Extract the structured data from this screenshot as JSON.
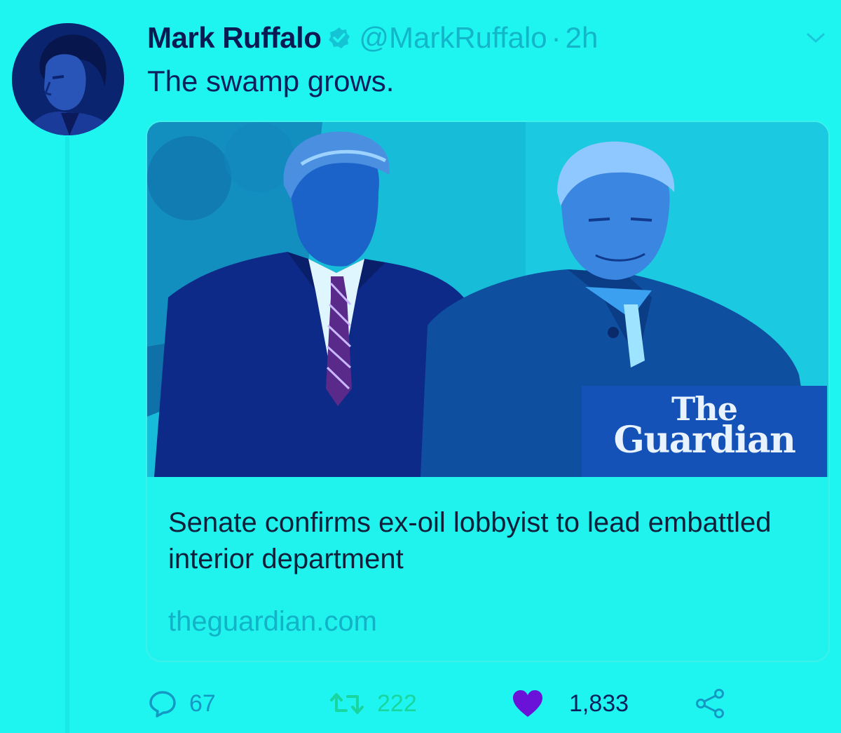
{
  "tweet": {
    "author_name": "Mark Ruffalo",
    "handle": "@MarkRuffalo",
    "separator": "·",
    "time": "2h",
    "text": "The swamp grows."
  },
  "card": {
    "publisher_logo_line1": "The",
    "publisher_logo_line2": "Guardian",
    "title": "Senate confirms ex-oil lobbyist to lead embattled interior department",
    "domain": "theguardian.com"
  },
  "actions": {
    "replies": "67",
    "retweets": "222",
    "likes": "1,833"
  },
  "colors": {
    "background": "#1ff5f0",
    "name": "#0a1a52",
    "muted": "#13b5c9",
    "retweet_green": "#19d6a0",
    "like_purple": "#6a12d8",
    "guardian_blue": "#1552b8"
  },
  "icons": {
    "verified": "verified-badge-icon",
    "caret": "chevron-down-icon",
    "reply": "reply-bubble-icon",
    "retweet": "retweet-icon",
    "like": "heart-icon",
    "share": "share-icon"
  }
}
